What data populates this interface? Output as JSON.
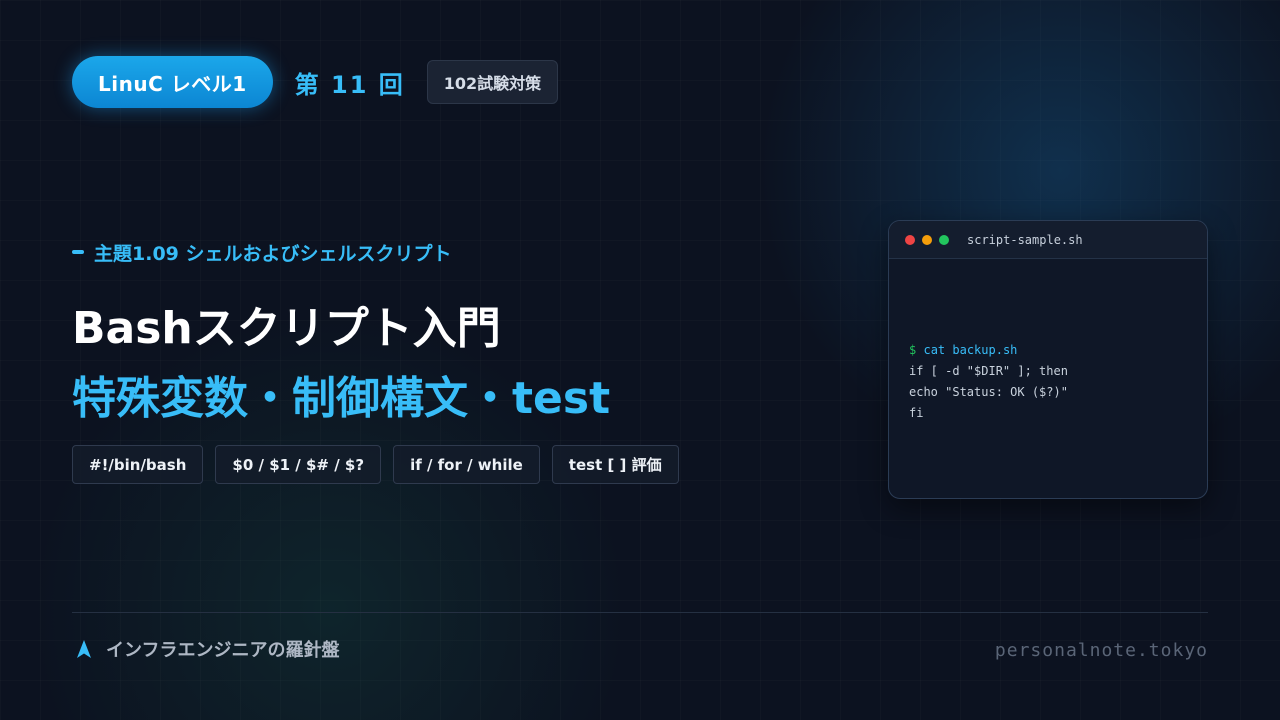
{
  "header": {
    "level_badge": "LinuC レベル1",
    "episode": "第 11 回",
    "exam_tag": "102試験対策"
  },
  "main": {
    "subject": "主題1.09 シェルおよびシェルスクリプト",
    "title_line1": "Bashスクリプト入門",
    "title_line2": "特殊変数・制御構文・test",
    "chips": [
      "#!/bin/bash",
      "$0 / $1 / $# / $?",
      "if / for / while",
      "test [ ] 評価"
    ]
  },
  "terminal": {
    "filename": "script-sample.sh",
    "prompt_sign": "$",
    "command": "cat backup.sh",
    "lines": [
      "if [ -d \"$DIR\" ]; then",
      "echo \"Status: OK ($?)\"",
      "fi"
    ]
  },
  "footer": {
    "brand": "インフラエンジニアの羅針盤",
    "url": "personalnote.tokyo",
    "icon": "compass-arrow-icon"
  },
  "colors": {
    "background": "#0c1220",
    "accent": "#38bdf8",
    "badge": "#0c86d3",
    "prompt_green": "#22c55e",
    "dot_red": "#ef4444",
    "dot_yellow": "#f59e0b",
    "dot_green": "#22c55e"
  }
}
